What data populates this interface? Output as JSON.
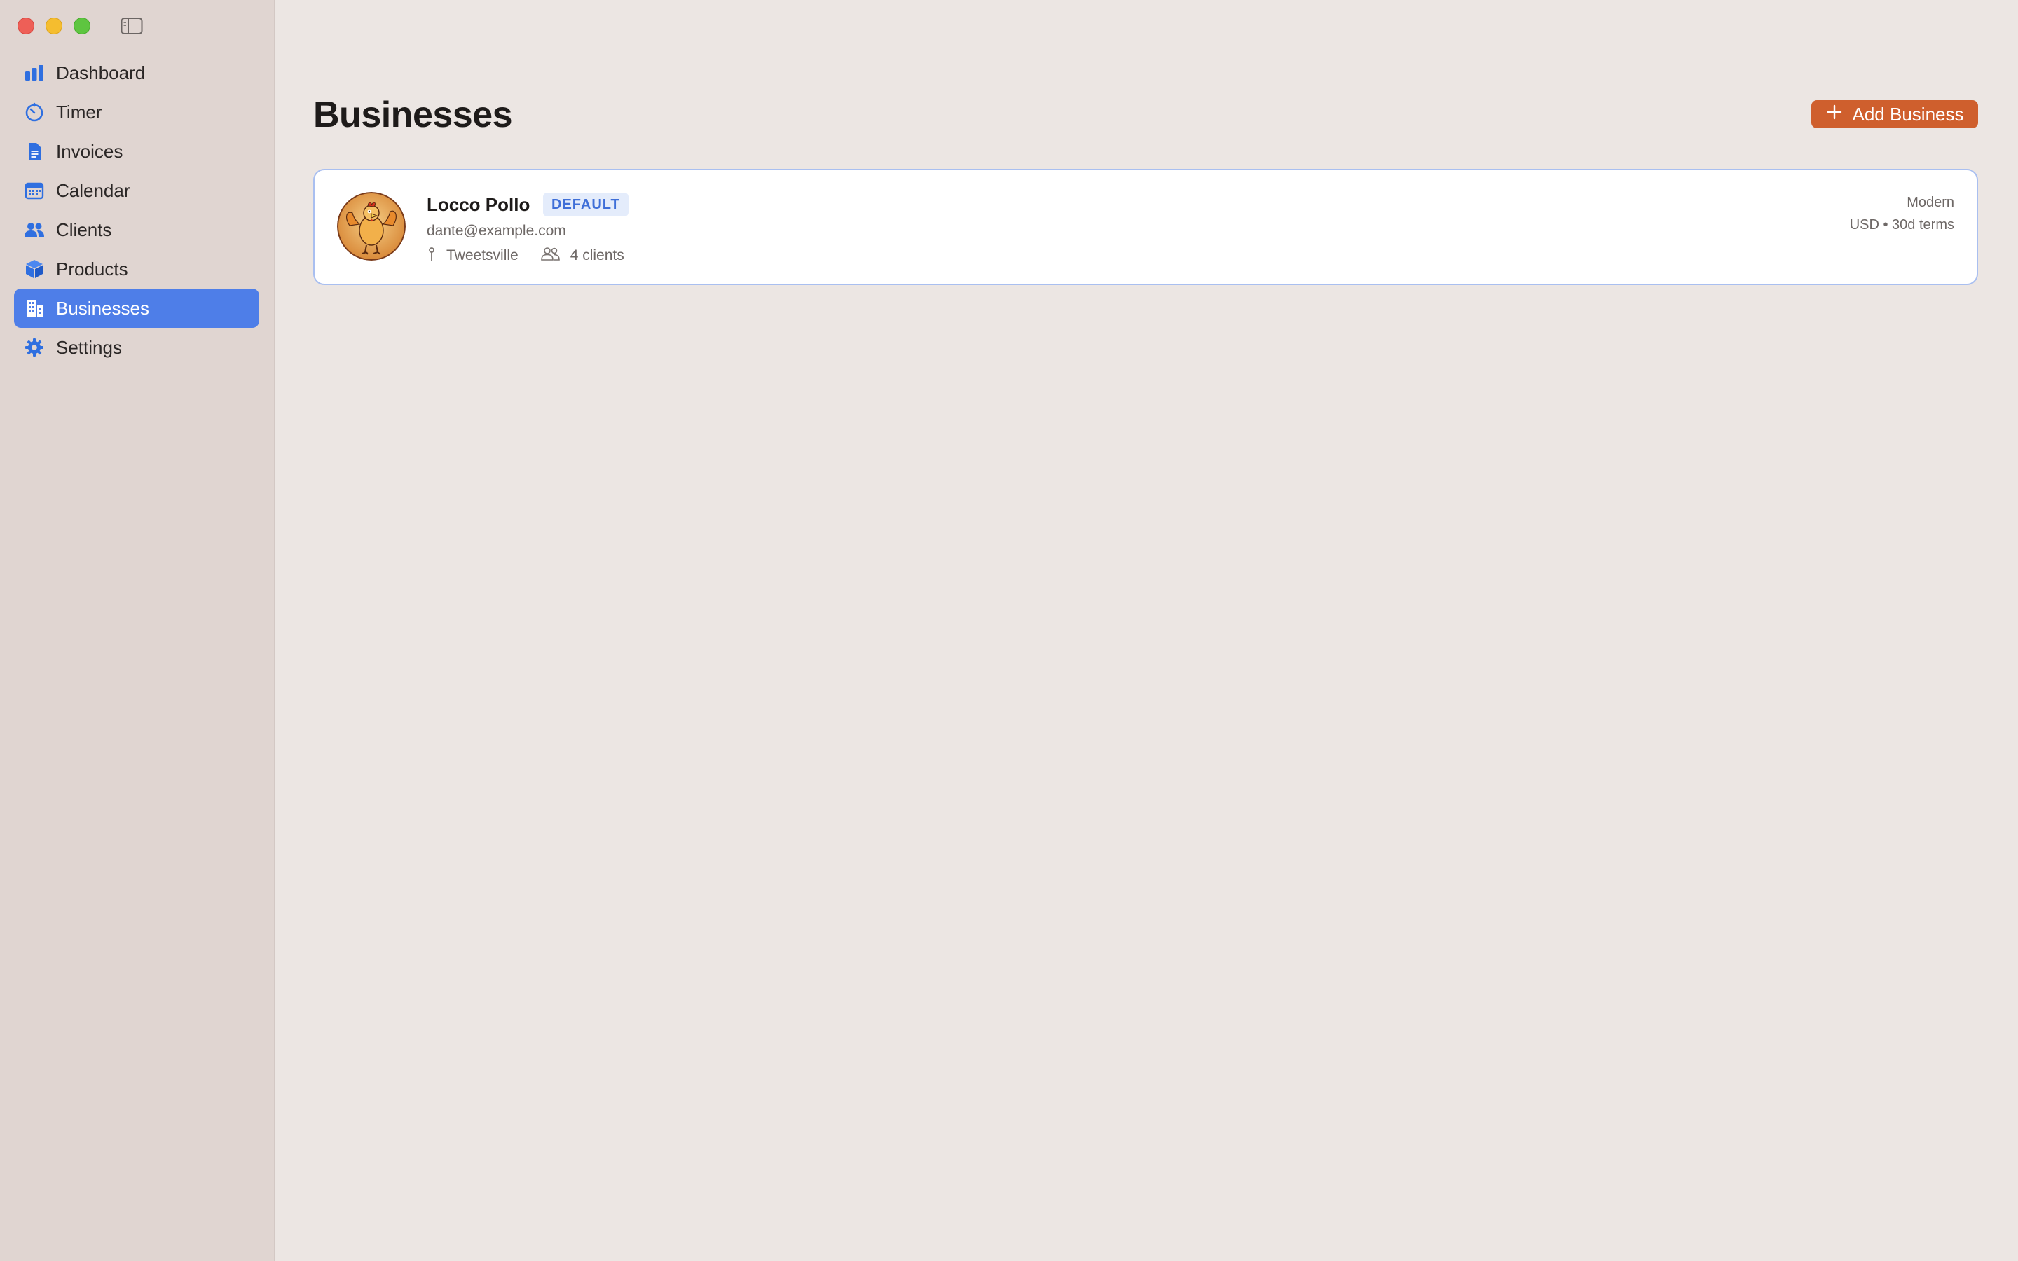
{
  "sidebar": {
    "items": [
      {
        "label": "Dashboard",
        "icon": "chart-bar-icon",
        "active": false
      },
      {
        "label": "Timer",
        "icon": "timer-icon",
        "active": false
      },
      {
        "label": "Invoices",
        "icon": "document-icon",
        "active": false
      },
      {
        "label": "Calendar",
        "icon": "calendar-icon",
        "active": false
      },
      {
        "label": "Clients",
        "icon": "people-icon",
        "active": false
      },
      {
        "label": "Products",
        "icon": "box-icon",
        "active": false
      },
      {
        "label": "Businesses",
        "icon": "building-icon",
        "active": true
      },
      {
        "label": "Settings",
        "icon": "gear-icon",
        "active": false
      }
    ]
  },
  "main": {
    "title": "Businesses",
    "add_button_label": "Add Business",
    "businesses": [
      {
        "name": "Locco Pollo",
        "badge": "DEFAULT",
        "email": "dante@example.com",
        "location": "Tweetsville",
        "clients": "4 clients",
        "template": "Modern",
        "terms": "USD • 30d terms"
      }
    ]
  },
  "colors": {
    "accent": "#4e7ee8",
    "add_button": "#cf5f2d",
    "sidebar_bg": "#e0d5d1",
    "main_bg": "#ece6e3"
  }
}
